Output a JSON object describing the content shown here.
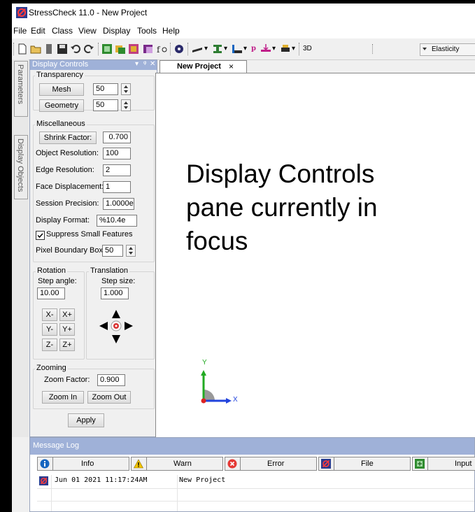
{
  "window": {
    "title": "StressCheck 11.0 - New Project",
    "logo_icon": "stresscheck-logo-icon"
  },
  "menu": [
    "File",
    "Edit",
    "Class",
    "View",
    "Display",
    "Tools",
    "Help"
  ],
  "toolbar": {
    "view_mode": "3D",
    "analysis": "Elasticity"
  },
  "vertical_tabs": [
    "Parameters",
    "Display Objects"
  ],
  "display_controls": {
    "title": "Display Controls",
    "pin_glyph": "▾ ↕ ✕",
    "transparency": {
      "label": "Transparency",
      "mesh_label": "Mesh",
      "mesh_value": "50",
      "geometry_label": "Geometry",
      "geometry_value": "50"
    },
    "misc": {
      "label": "Miscellaneous",
      "shrink_label": "Shrink Factor:",
      "shrink_value": "0.700",
      "object_res_label": "Object Resolution:",
      "object_res_value": "100",
      "edge_res_label": "Edge Resolution:",
      "edge_res_value": "2",
      "face_disp_label": "Face Displacement:",
      "face_disp_value": "1",
      "session_prec_label": "Session Precision:",
      "session_prec_value": "1.0000e",
      "display_format_label": "Display Format:",
      "display_format_value": "%10.4e",
      "suppress_label": "Suppress Small Features",
      "suppress_checked": true,
      "pixel_box_label": "Pixel Boundary Box:",
      "pixel_box_value": "50"
    },
    "rotation": {
      "label": "Rotation",
      "step_label": "Step angle:",
      "step_value": "10.00",
      "buttons": [
        "X-",
        "X+",
        "Y-",
        "Y+",
        "Z-",
        "Z+"
      ]
    },
    "translation": {
      "label": "Translation",
      "step_label": "Step size:",
      "step_value": "1.000"
    },
    "zooming": {
      "label": "Zooming",
      "factor_label": "Zoom Factor:",
      "factor_value": "0.900",
      "zoom_in": "Zoom In",
      "zoom_out": "Zoom Out"
    },
    "apply": "Apply"
  },
  "document": {
    "tab": "New Project",
    "tab_close": "×",
    "overlay_lines": [
      "Display Controls",
      "pane currently in",
      "focus"
    ],
    "axis_x": "X",
    "axis_y": "Y"
  },
  "message_log": {
    "title": "Message Log",
    "filters": [
      "Info",
      "Warn",
      "Error",
      "File",
      "Input"
    ],
    "entries": [
      {
        "date": "Jun 01 2021 11:17:24AM",
        "message": "New Project"
      }
    ]
  },
  "colors": {
    "pane_header": "#9fb1d8",
    "info": "#1565c0",
    "warn": "#f2c400",
    "error": "#e53935",
    "input_green": "#2e8b2e"
  }
}
